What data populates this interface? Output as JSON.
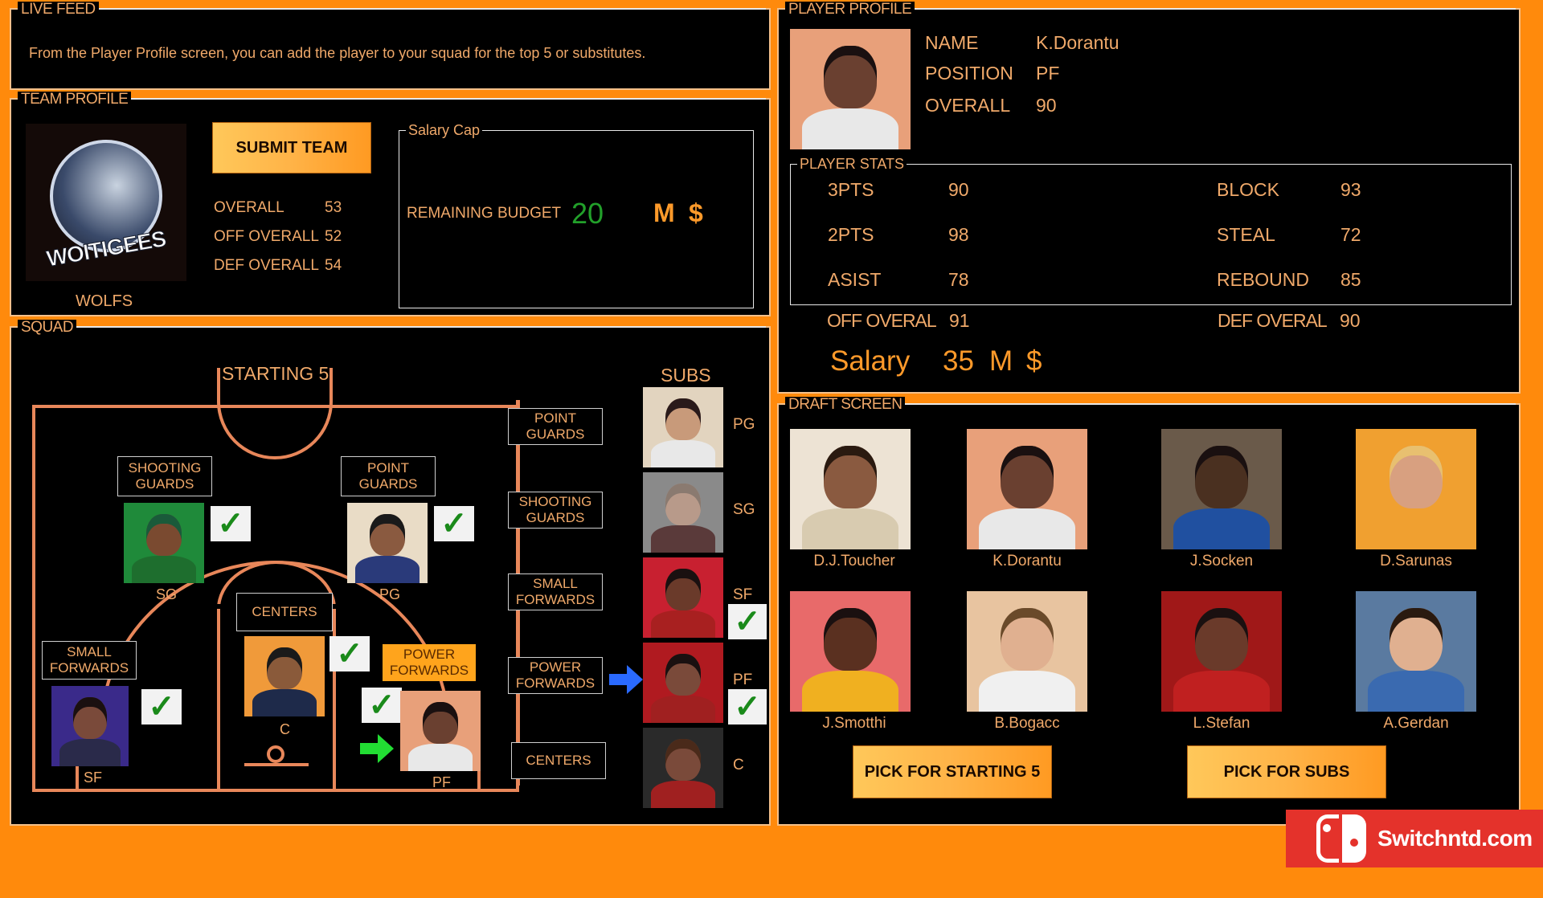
{
  "live_feed": {
    "title": "LIVE FEED",
    "message": "From the Player Profile screen, you can add the player to your squad for the top 5 or substitutes."
  },
  "team_profile": {
    "title": "TEAM PROFILE",
    "team_name": "WOLFS",
    "logo_text": "WOITIGEES",
    "submit_label": "SUBMIT TEAM",
    "stats": [
      {
        "label": "OVERALL",
        "value": "53"
      },
      {
        "label": "OFF OVERALL",
        "value": "52"
      },
      {
        "label": "DEF OVERALL",
        "value": "54"
      }
    ],
    "salary_cap": {
      "title": "Salary Cap",
      "label": "REMAINING BUDGET",
      "value": "20",
      "unit": "M",
      "currency": "$"
    }
  },
  "squad": {
    "title": "SQUAD",
    "starting_title": "STARTING 5",
    "subs_title": "SUBS",
    "starters": [
      {
        "position_label": "SHOOTING GUARDS",
        "abbr": "SG",
        "checked": true,
        "skin": "#7a4a30",
        "bg": "#1f8a3a",
        "jersey": "#1e6e2e",
        "hair": "#1a5a3a"
      },
      {
        "position_label": "POINT GUARDS",
        "abbr": "PG",
        "checked": true,
        "skin": "#8a5a40",
        "bg": "#e9dcc6",
        "jersey": "#2a3a7a",
        "hair": "#1a1a1a"
      },
      {
        "position_label": "CENTERS",
        "abbr": "C",
        "checked": true,
        "skin": "#8a5a3a",
        "bg": "#f09a3a",
        "jersey": "#1e2a4a",
        "hair": "#1a1a1a"
      },
      {
        "position_label": "SMALL FORWARDS",
        "abbr": "SF",
        "checked": true,
        "skin": "#7a4a3a",
        "bg": "#3a2a8a",
        "jersey": "#2a2a4a",
        "hair": "#1a1010"
      },
      {
        "position_label": "POWER FORWARDS",
        "abbr": "PF",
        "checked": true,
        "highlighted": true,
        "skin": "#6a4030",
        "bg": "#e8a07a",
        "jersey": "#e8e8e8",
        "hair": "#1a1010"
      }
    ],
    "sub_position_labels": [
      "POINT GUARDS",
      "SHOOTING GUARDS",
      "SMALL FORWARDS",
      "POWER FORWARDS",
      "CENTERS"
    ],
    "subs": [
      {
        "abbr": "PG",
        "checked": false,
        "skin": "#c89a7a",
        "bg": "#e2d4bf",
        "jersey": "#e8e8e8",
        "hair": "#2a1a1a"
      },
      {
        "abbr": "SG",
        "checked": false,
        "skin": "#b89a8a",
        "bg": "#8a8a8a",
        "jersey": "#5a3a3a",
        "hair": "#8a7a70"
      },
      {
        "abbr": "SF",
        "checked": true,
        "skin": "#6a3a2a",
        "bg": "#c82030",
        "jersey": "#a82020",
        "hair": "#1a1010"
      },
      {
        "abbr": "PF",
        "checked": true,
        "skin": "#7a4a3a",
        "bg": "#b01a20",
        "jersey": "#a02020",
        "hair": "#1a1010"
      },
      {
        "abbr": "C",
        "checked": false,
        "skin": "#7a4a3a",
        "bg": "#2a2a2a",
        "jersey": "#a02020",
        "hair": "#4a2a1a"
      }
    ]
  },
  "player_profile": {
    "title": "PLAYER PROFILE",
    "fields": [
      {
        "label": "NAME",
        "value": "K.Dorantu"
      },
      {
        "label": "POSITION",
        "value": "PF"
      },
      {
        "label": "OVERALL",
        "value": "90"
      }
    ],
    "stats_title": "PLAYER STATS",
    "stats": [
      {
        "label": "3PTS",
        "value": "90"
      },
      {
        "label": "BLOCK",
        "value": "93"
      },
      {
        "label": "2PTS",
        "value": "98"
      },
      {
        "label": "STEAL",
        "value": "72"
      },
      {
        "label": "ASIST",
        "value": "78"
      },
      {
        "label": "REBOUND",
        "value": "85"
      }
    ],
    "off_overall": {
      "label": "OFF OVERAL",
      "value": "91"
    },
    "def_overall": {
      "label": "DEF OVERAL",
      "value": "90"
    },
    "salary": {
      "label": "Salary",
      "value": "35",
      "unit": "M",
      "currency": "$"
    },
    "portrait": {
      "skin": "#6a4030",
      "bg": "#e8a07a",
      "jersey": "#e8e8e8",
      "hair": "#1a1010"
    }
  },
  "draft": {
    "title": "DRAFT SCREEN",
    "players": [
      {
        "name": "D.J.Toucher",
        "skin": "#8a5a40",
        "bg": "#ede3d4",
        "jersey": "#d8cbb0",
        "hair": "#2a1a10"
      },
      {
        "name": "K.Dorantu",
        "skin": "#6a4030",
        "bg": "#e8a07a",
        "jersey": "#e8e8e8",
        "hair": "#1a1010"
      },
      {
        "name": "J.Socken",
        "skin": "#4a3020",
        "bg": "#6a5a4a",
        "jersey": "#2050a0",
        "hair": "#1a1010"
      },
      {
        "name": "D.Sarunas",
        "skin": "#d8a080",
        "bg": "#f0a030",
        "jersey": "#f0a030",
        "hair": "#e8c070"
      },
      {
        "name": "J.Smotthi",
        "skin": "#5a3020",
        "bg": "#e86a6a",
        "jersey": "#f0b020",
        "hair": "#1a1010"
      },
      {
        "name": "B.Bogacc",
        "skin": "#e0b090",
        "bg": "#e8c4a0",
        "jersey": "#f0f0f0",
        "hair": "#6a4a2a"
      },
      {
        "name": "L.Stefan",
        "skin": "#6a3a2a",
        "bg": "#a01818",
        "jersey": "#c02020",
        "hair": "#1a1010"
      },
      {
        "name": "A.Gerdan",
        "skin": "#e0b090",
        "bg": "#5a7aa0",
        "jersey": "#3a6ab0",
        "hair": "#2a1a10"
      }
    ],
    "pick_starting_label": "PICK FOR STARTING 5",
    "pick_subs_label": "PICK FOR SUBS"
  },
  "watermark": {
    "text": "Switchntd.com",
    "color": "#e4322b"
  }
}
